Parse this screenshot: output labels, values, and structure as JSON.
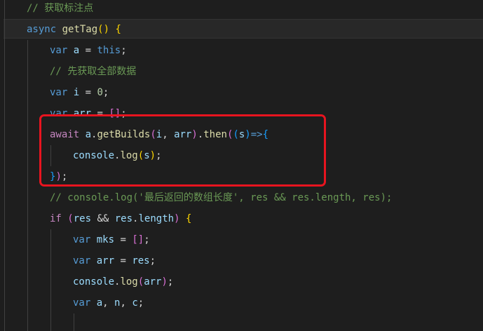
{
  "editor": {
    "lines": [
      {
        "tokens": [
          {
            "text": "// 获取标注点",
            "cls": "c-comment"
          }
        ]
      },
      {
        "tokens": [
          {
            "text": "async",
            "cls": "c-kw"
          },
          {
            "text": " ",
            "cls": "c-plain"
          },
          {
            "text": "getTag",
            "cls": "c-fn"
          },
          {
            "text": "()",
            "cls": "c-br1"
          },
          {
            "text": " ",
            "cls": "c-plain"
          },
          {
            "text": "{",
            "cls": "c-br1"
          }
        ]
      },
      {
        "tokens": [
          {
            "text": "var",
            "cls": "c-kw"
          },
          {
            "text": " ",
            "cls": "c-plain"
          },
          {
            "text": "a",
            "cls": "c-var"
          },
          {
            "text": " = ",
            "cls": "c-plain"
          },
          {
            "text": "this",
            "cls": "c-kw"
          },
          {
            "text": ";",
            "cls": "c-plain"
          }
        ]
      },
      {
        "tokens": [
          {
            "text": "// 先获取全部数据",
            "cls": "c-comment"
          }
        ]
      },
      {
        "tokens": [
          {
            "text": "var",
            "cls": "c-kw"
          },
          {
            "text": " ",
            "cls": "c-plain"
          },
          {
            "text": "i",
            "cls": "c-var"
          },
          {
            "text": " = ",
            "cls": "c-plain"
          },
          {
            "text": "0",
            "cls": "c-num"
          },
          {
            "text": ";",
            "cls": "c-plain"
          }
        ]
      },
      {
        "tokens": [
          {
            "text": "var",
            "cls": "c-kw"
          },
          {
            "text": " ",
            "cls": "c-plain"
          },
          {
            "text": "arr",
            "cls": "c-var"
          },
          {
            "text": " = ",
            "cls": "c-plain"
          },
          {
            "text": "[]",
            "cls": "c-br2"
          },
          {
            "text": ";",
            "cls": "c-plain"
          }
        ]
      },
      {
        "tokens": [
          {
            "text": "await",
            "cls": "c-kw-ctrl"
          },
          {
            "text": " ",
            "cls": "c-plain"
          },
          {
            "text": "a",
            "cls": "c-var"
          },
          {
            "text": ".",
            "cls": "c-plain"
          },
          {
            "text": "getBuilds",
            "cls": "c-fn"
          },
          {
            "text": "(",
            "cls": "c-br2"
          },
          {
            "text": "i",
            "cls": "c-var"
          },
          {
            "text": ", ",
            "cls": "c-plain"
          },
          {
            "text": "arr",
            "cls": "c-var"
          },
          {
            "text": ")",
            "cls": "c-br2"
          },
          {
            "text": ".",
            "cls": "c-plain"
          },
          {
            "text": "then",
            "cls": "c-fn"
          },
          {
            "text": "(",
            "cls": "c-br2"
          },
          {
            "text": "(",
            "cls": "c-br3"
          },
          {
            "text": "s",
            "cls": "c-var"
          },
          {
            "text": ")",
            "cls": "c-br3"
          },
          {
            "text": "=>",
            "cls": "c-kw"
          },
          {
            "text": "{",
            "cls": "c-br3"
          }
        ]
      },
      {
        "tokens": [
          {
            "text": "console",
            "cls": "c-var"
          },
          {
            "text": ".",
            "cls": "c-plain"
          },
          {
            "text": "log",
            "cls": "c-fn"
          },
          {
            "text": "(",
            "cls": "c-br1"
          },
          {
            "text": "s",
            "cls": "c-var"
          },
          {
            "text": ")",
            "cls": "c-br1"
          },
          {
            "text": ";",
            "cls": "c-plain"
          }
        ]
      },
      {
        "tokens": [
          {
            "text": "}",
            "cls": "c-br3"
          },
          {
            "text": ")",
            "cls": "c-br2"
          },
          {
            "text": ";",
            "cls": "c-plain"
          }
        ]
      },
      {
        "tokens": [
          {
            "text": "// console.log('最后返回的数组长度', res && res.length, res);",
            "cls": "c-comment"
          }
        ]
      },
      {
        "tokens": [
          {
            "text": "if",
            "cls": "c-kw-ctrl"
          },
          {
            "text": " ",
            "cls": "c-plain"
          },
          {
            "text": "(",
            "cls": "c-br2"
          },
          {
            "text": "res",
            "cls": "c-var"
          },
          {
            "text": " && ",
            "cls": "c-plain"
          },
          {
            "text": "res",
            "cls": "c-var"
          },
          {
            "text": ".",
            "cls": "c-plain"
          },
          {
            "text": "length",
            "cls": "c-var"
          },
          {
            "text": ")",
            "cls": "c-br2"
          },
          {
            "text": " ",
            "cls": "c-plain"
          },
          {
            "text": "{",
            "cls": "c-br1"
          }
        ]
      },
      {
        "tokens": [
          {
            "text": "var",
            "cls": "c-kw"
          },
          {
            "text": " ",
            "cls": "c-plain"
          },
          {
            "text": "mks",
            "cls": "c-var"
          },
          {
            "text": " = ",
            "cls": "c-plain"
          },
          {
            "text": "[]",
            "cls": "c-br2"
          },
          {
            "text": ";",
            "cls": "c-plain"
          }
        ]
      },
      {
        "tokens": [
          {
            "text": "var",
            "cls": "c-kw"
          },
          {
            "text": " ",
            "cls": "c-plain"
          },
          {
            "text": "arr",
            "cls": "c-var"
          },
          {
            "text": " = ",
            "cls": "c-plain"
          },
          {
            "text": "res",
            "cls": "c-var"
          },
          {
            "text": ";",
            "cls": "c-plain"
          }
        ]
      },
      {
        "tokens": [
          {
            "text": "console",
            "cls": "c-var"
          },
          {
            "text": ".",
            "cls": "c-plain"
          },
          {
            "text": "log",
            "cls": "c-fn"
          },
          {
            "text": "(",
            "cls": "c-br2"
          },
          {
            "text": "arr",
            "cls": "c-var"
          },
          {
            "text": ")",
            "cls": "c-br2"
          },
          {
            "text": ";",
            "cls": "c-plain"
          }
        ]
      },
      {
        "tokens": [
          {
            "text": "var",
            "cls": "c-kw"
          },
          {
            "text": " ",
            "cls": "c-plain"
          },
          {
            "text": "a",
            "cls": "c-var"
          },
          {
            "text": ", ",
            "cls": "c-plain"
          },
          {
            "text": "n",
            "cls": "c-var"
          },
          {
            "text": ", ",
            "cls": "c-plain"
          },
          {
            "text": "c",
            "cls": "c-var"
          },
          {
            "text": ";",
            "cls": "c-plain"
          }
        ]
      }
    ],
    "highlighted_line": 2,
    "highlighted_block_lines": [
      7,
      8,
      9
    ]
  },
  "colors": {
    "background": "#1e1e1e",
    "comment": "#6a9955",
    "keyword": "#569cd6",
    "control_keyword": "#c586c0",
    "function": "#dcdcaa",
    "variable": "#9cdcfe",
    "number": "#b5cea8",
    "annotation_box": "#e8141f"
  }
}
